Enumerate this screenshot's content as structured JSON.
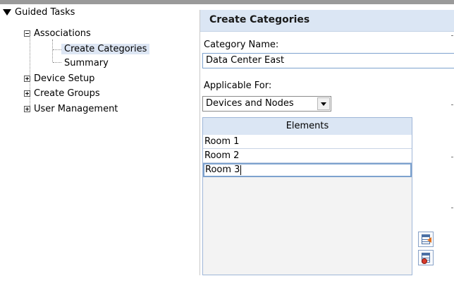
{
  "tree": {
    "root_label": "Guided Tasks",
    "items": [
      {
        "label": "Associations",
        "expanded": true,
        "children": [
          {
            "label": "Create Categories",
            "selected": true
          },
          {
            "label": "Summary"
          }
        ]
      },
      {
        "label": "Device Setup",
        "expanded": false
      },
      {
        "label": "Create Groups",
        "expanded": false
      },
      {
        "label": "User Management",
        "expanded": false
      }
    ]
  },
  "panel": {
    "title": "Create Categories",
    "category_name_label": "Category Name:",
    "category_name_value": "Data Center East",
    "applicable_label": "Applicable For:",
    "applicable_value": "Devices and Nodes",
    "elements_header": "Elements",
    "elements": [
      "Room 1",
      "Room 2",
      "Room 3"
    ],
    "active_row_index": 2
  },
  "icons": {
    "add_row": "insert-row-icon",
    "delete_row": "delete-row-icon",
    "tree_collapse": "minus-box-icon",
    "tree_expand": "plus-box-icon",
    "root_toggle": "triangle-down-icon"
  },
  "colors": {
    "header_bg": "#dbe6f4",
    "selection_bg": "#dde6f4",
    "input_border": "#7da2ce"
  }
}
